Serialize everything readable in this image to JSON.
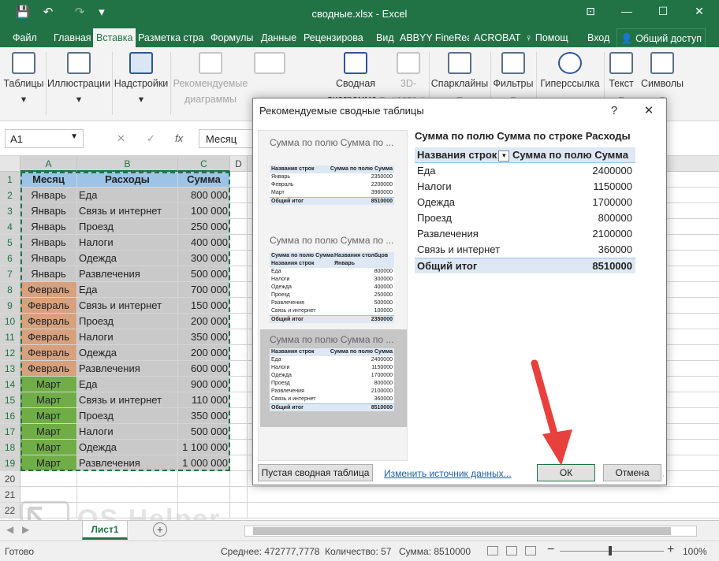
{
  "window": {
    "title": "сводные.xlsx - Excel",
    "minimize": "—",
    "restore": "☐",
    "close": "✕",
    "ribbon_opts": "⊡"
  },
  "quick_access": {
    "save": "💾",
    "undo": "↶",
    "redo": "↷",
    "customize": "▾"
  },
  "menu": {
    "tabs": [
      "Файл",
      "Главная",
      "Вставка",
      "Разметка стра",
      "Формулы",
      "Данные",
      "Рецензирова",
      "Вид",
      "ABBYY FineRea",
      "ACROBAT",
      "♀ Помощ",
      "Вход"
    ],
    "share": "Общий доступ"
  },
  "ribbon": {
    "groups": [
      {
        "label": "Таблицы",
        "sub": "▾"
      },
      {
        "label": "Иллюстрации",
        "sub": "▾"
      },
      {
        "label": "Надстройки",
        "sub": "▾"
      },
      {
        "label": "Рекомендуемые",
        "sub": "диаграммы"
      },
      {
        "label": "Сводная",
        "sub": "диаграмма ▾"
      },
      {
        "label": "3D-",
        "sub": "карта ▾"
      },
      {
        "label": "Спарклайны",
        "sub": "▾"
      },
      {
        "label": "Фильтры",
        "sub": "▾"
      },
      {
        "label": "Гиперссылка",
        "sub": ""
      },
      {
        "label": "Текст",
        "sub": "▾"
      },
      {
        "label": "Символы",
        "sub": "▾"
      }
    ]
  },
  "formula_bar": {
    "name_box": "A1",
    "cancel": "✕",
    "confirm": "✓",
    "fx": "fx",
    "value": "Месяц"
  },
  "grid": {
    "columns": [
      "A",
      "B",
      "C",
      "D"
    ],
    "rows": [
      "1",
      "2",
      "3",
      "4",
      "5",
      "6",
      "7",
      "8",
      "9",
      "10",
      "11",
      "12",
      "13",
      "14",
      "15",
      "16",
      "17",
      "18",
      "19",
      "20",
      "21",
      "22"
    ],
    "headers": [
      "Месяц",
      "Расходы",
      "Сумма"
    ],
    "data": [
      [
        "Январь",
        "Еда",
        "800 000"
      ],
      [
        "Январь",
        "Связь и интернет",
        "100 000"
      ],
      [
        "Январь",
        "Проезд",
        "250 000"
      ],
      [
        "Январь",
        "Налоги",
        "400 000"
      ],
      [
        "Январь",
        "Одежда",
        "300 000"
      ],
      [
        "Январь",
        "Развлечения",
        "500 000"
      ],
      [
        "Февраль",
        "Еда",
        "700 000"
      ],
      [
        "Февраль",
        "Связь и интернет",
        "150 000"
      ],
      [
        "Февраль",
        "Проезд",
        "200 000"
      ],
      [
        "Февраль",
        "Налоги",
        "350 000"
      ],
      [
        "Февраль",
        "Одежда",
        "200 000"
      ],
      [
        "Февраль",
        "Развлечения",
        "600 000"
      ],
      [
        "Март",
        "Еда",
        "900 000"
      ],
      [
        "Март",
        "Связь и интернет",
        "110 000"
      ],
      [
        "Март",
        "Проезд",
        "350 000"
      ],
      [
        "Март",
        "Налоги",
        "500 000"
      ],
      [
        "Март",
        "Одежда",
        "1 100 000"
      ],
      [
        "Март",
        "Развлечения",
        "1 000 000"
      ]
    ],
    "colors": {
      "header": "#9dc3e6",
      "jan": "#c9c9c9",
      "feb": "#d7a17e",
      "mar": "#70ad47"
    }
  },
  "dialog": {
    "title": "Рекомендуемые сводные таблицы",
    "help": "?",
    "close": "✕",
    "thumbs": [
      {
        "title": "Сумма по полю Сумма по ...",
        "head": [
          "Названия строк",
          "Сумма по полю Сумма"
        ],
        "rows": [
          [
            "Январь",
            "2350000"
          ],
          [
            "Февраль",
            "2200000"
          ],
          [
            "Март",
            "3960000"
          ]
        ],
        "total": [
          "Общий итог",
          "8510000"
        ]
      },
      {
        "title": "Сумма по полю Сумма по ...",
        "top": [
          "Сумма по полю Сумма",
          "Названия столбцов"
        ],
        "head": [
          "Названия строк",
          "Январь"
        ],
        "rows": [
          [
            "Еда",
            "800000"
          ],
          [
            "Налоги",
            "300000"
          ],
          [
            "Одежда",
            "400000"
          ],
          [
            "Проезд",
            "250000"
          ],
          [
            "Развлечения",
            "500000"
          ],
          [
            "Связь и интернет",
            "100000"
          ]
        ],
        "total": [
          "Общий итог",
          "2350000"
        ]
      },
      {
        "title": "Сумма по полю Сумма по ...",
        "head": [
          "Названия строк",
          "Сумма по полю Сумма"
        ],
        "rows": [
          [
            "Еда",
            "2400000"
          ],
          [
            "Налоги",
            "1150000"
          ],
          [
            "Одежда",
            "1700000"
          ],
          [
            "Проезд",
            "800000"
          ],
          [
            "Развлечения",
            "2100000"
          ],
          [
            "Связь и интернет",
            "360000"
          ]
        ],
        "total": [
          "Общий итог",
          "8510000"
        ]
      }
    ],
    "preview": {
      "title": "Сумма по полю Сумма по строке Расходы",
      "head": [
        "Названия строк",
        "Сумма по полю Сумма"
      ],
      "rows": [
        [
          "Еда",
          "2400000"
        ],
        [
          "Налоги",
          "1150000"
        ],
        [
          "Одежда",
          "1700000"
        ],
        [
          "Проезд",
          "800000"
        ],
        [
          "Развлечения",
          "2100000"
        ],
        [
          "Связь и интернет",
          "360000"
        ]
      ],
      "total": [
        "Общий итог",
        "8510000"
      ]
    },
    "blank_button": "Пустая сводная таблица",
    "change_source_link": "Изменить источник данных...",
    "ok": "ОК",
    "cancel": "Отмена"
  },
  "sheets": {
    "active": "Лист1",
    "add": "+"
  },
  "status": {
    "ready": "Готово",
    "average": "Среднее: 472777,7778",
    "count": "Количество: 57",
    "sum": "Сумма: 8510000",
    "zoom": "100%"
  },
  "watermark": "OS Helper"
}
